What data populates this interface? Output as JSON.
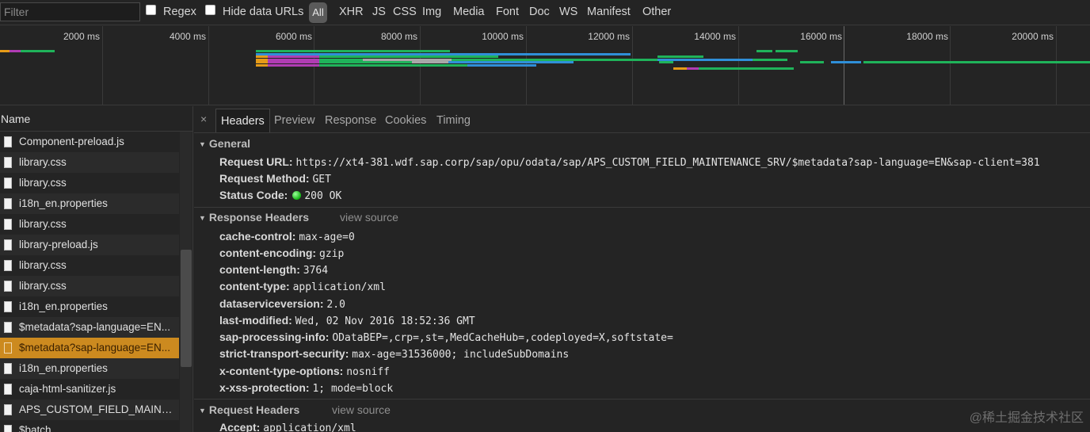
{
  "filterbar": {
    "filter_placeholder": "Filter",
    "regex_label": "Regex",
    "hide_data_urls_label": "Hide data URLs",
    "all_label": "All",
    "types": [
      "XHR",
      "JS",
      "CSS",
      "Img",
      "Media",
      "Font",
      "Doc",
      "WS",
      "Manifest",
      "Other"
    ]
  },
  "overview": {
    "ticks": [
      "2000 ms",
      "4000 ms",
      "6000 ms",
      "8000 ms",
      "10000 ms",
      "12000 ms",
      "14000 ms",
      "16000 ms",
      "18000 ms",
      "20000 ms"
    ]
  },
  "list": {
    "header": "Name",
    "items": [
      "Component-preload.js",
      "library.css",
      "library.css",
      "i18n_en.properties",
      "library.css",
      "library-preload.js",
      "library.css",
      "library.css",
      "i18n_en.properties",
      "$metadata?sap-language=EN...",
      "$metadata?sap-language=EN...",
      "i18n_en.properties",
      "caja-html-sanitizer.js",
      "APS_CUSTOM_FIELD_MAINTE...",
      "$batch"
    ],
    "selected_index": 10
  },
  "details": {
    "close_label": "×",
    "tabs": [
      "Headers",
      "Preview",
      "Response",
      "Cookies",
      "Timing"
    ],
    "active_tab": "Headers",
    "general": {
      "title": "General",
      "request_url_key": "Request URL:",
      "request_url": "https://xt4-381.wdf.sap.corp/sap/opu/odata/sap/APS_CUSTOM_FIELD_MAINTENANCE_SRV/$metadata?sap-language=EN&sap-client=381",
      "request_method_key": "Request Method:",
      "request_method": "GET",
      "status_code_key": "Status Code:",
      "status_code": "200 OK"
    },
    "response_headers": {
      "title": "Response Headers",
      "view_source": "view source",
      "items": [
        {
          "k": "cache-control:",
          "v": "max-age=0"
        },
        {
          "k": "content-encoding:",
          "v": "gzip"
        },
        {
          "k": "content-length:",
          "v": "3764"
        },
        {
          "k": "content-type:",
          "v": "application/xml"
        },
        {
          "k": "dataserviceversion:",
          "v": "2.0"
        },
        {
          "k": "last-modified:",
          "v": "Wed, 02 Nov 2016 18:52:36 GMT"
        },
        {
          "k": "sap-processing-info:",
          "v": "ODataBEP=,crp=,st=,MedCacheHub=,codeployed=X,softstate="
        },
        {
          "k": "strict-transport-security:",
          "v": "max-age=31536000; includeSubDomains"
        },
        {
          "k": "x-content-type-options:",
          "v": "nosniff"
        },
        {
          "k": "x-xss-protection:",
          "v": "1; mode=block"
        }
      ]
    },
    "request_headers": {
      "title": "Request Headers",
      "view_source": "view source",
      "first_key": "Accept:",
      "first_value": "application/xml"
    }
  },
  "watermark": "@稀土掘金技术社区",
  "colors": {
    "selected_row": "#cc8a1f",
    "bar_green": "#1fb35a",
    "bar_blue": "#2f8fd8",
    "bar_purple": "#b03cb3",
    "bar_orange": "#e69b18",
    "status_ok": "#12b312"
  }
}
